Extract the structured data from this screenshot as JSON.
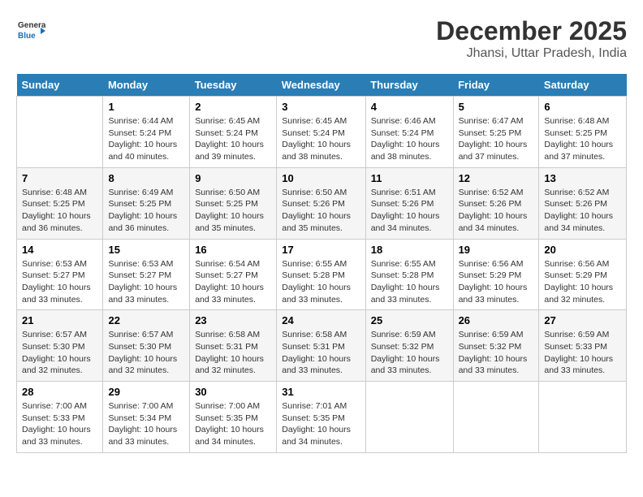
{
  "header": {
    "logo_line1": "General",
    "logo_line2": "Blue",
    "month_title": "December 2025",
    "subtitle": "Jhansi, Uttar Pradesh, India"
  },
  "days_of_week": [
    "Sunday",
    "Monday",
    "Tuesday",
    "Wednesday",
    "Thursday",
    "Friday",
    "Saturday"
  ],
  "weeks": [
    [
      {
        "day": "",
        "info": ""
      },
      {
        "day": "1",
        "info": "Sunrise: 6:44 AM\nSunset: 5:24 PM\nDaylight: 10 hours\nand 40 minutes."
      },
      {
        "day": "2",
        "info": "Sunrise: 6:45 AM\nSunset: 5:24 PM\nDaylight: 10 hours\nand 39 minutes."
      },
      {
        "day": "3",
        "info": "Sunrise: 6:45 AM\nSunset: 5:24 PM\nDaylight: 10 hours\nand 38 minutes."
      },
      {
        "day": "4",
        "info": "Sunrise: 6:46 AM\nSunset: 5:24 PM\nDaylight: 10 hours\nand 38 minutes."
      },
      {
        "day": "5",
        "info": "Sunrise: 6:47 AM\nSunset: 5:25 PM\nDaylight: 10 hours\nand 37 minutes."
      },
      {
        "day": "6",
        "info": "Sunrise: 6:48 AM\nSunset: 5:25 PM\nDaylight: 10 hours\nand 37 minutes."
      }
    ],
    [
      {
        "day": "7",
        "info": "Sunrise: 6:48 AM\nSunset: 5:25 PM\nDaylight: 10 hours\nand 36 minutes."
      },
      {
        "day": "8",
        "info": "Sunrise: 6:49 AM\nSunset: 5:25 PM\nDaylight: 10 hours\nand 36 minutes."
      },
      {
        "day": "9",
        "info": "Sunrise: 6:50 AM\nSunset: 5:25 PM\nDaylight: 10 hours\nand 35 minutes."
      },
      {
        "day": "10",
        "info": "Sunrise: 6:50 AM\nSunset: 5:26 PM\nDaylight: 10 hours\nand 35 minutes."
      },
      {
        "day": "11",
        "info": "Sunrise: 6:51 AM\nSunset: 5:26 PM\nDaylight: 10 hours\nand 34 minutes."
      },
      {
        "day": "12",
        "info": "Sunrise: 6:52 AM\nSunset: 5:26 PM\nDaylight: 10 hours\nand 34 minutes."
      },
      {
        "day": "13",
        "info": "Sunrise: 6:52 AM\nSunset: 5:26 PM\nDaylight: 10 hours\nand 34 minutes."
      }
    ],
    [
      {
        "day": "14",
        "info": "Sunrise: 6:53 AM\nSunset: 5:27 PM\nDaylight: 10 hours\nand 33 minutes."
      },
      {
        "day": "15",
        "info": "Sunrise: 6:53 AM\nSunset: 5:27 PM\nDaylight: 10 hours\nand 33 minutes."
      },
      {
        "day": "16",
        "info": "Sunrise: 6:54 AM\nSunset: 5:27 PM\nDaylight: 10 hours\nand 33 minutes."
      },
      {
        "day": "17",
        "info": "Sunrise: 6:55 AM\nSunset: 5:28 PM\nDaylight: 10 hours\nand 33 minutes."
      },
      {
        "day": "18",
        "info": "Sunrise: 6:55 AM\nSunset: 5:28 PM\nDaylight: 10 hours\nand 33 minutes."
      },
      {
        "day": "19",
        "info": "Sunrise: 6:56 AM\nSunset: 5:29 PM\nDaylight: 10 hours\nand 33 minutes."
      },
      {
        "day": "20",
        "info": "Sunrise: 6:56 AM\nSunset: 5:29 PM\nDaylight: 10 hours\nand 32 minutes."
      }
    ],
    [
      {
        "day": "21",
        "info": "Sunrise: 6:57 AM\nSunset: 5:30 PM\nDaylight: 10 hours\nand 32 minutes."
      },
      {
        "day": "22",
        "info": "Sunrise: 6:57 AM\nSunset: 5:30 PM\nDaylight: 10 hours\nand 32 minutes."
      },
      {
        "day": "23",
        "info": "Sunrise: 6:58 AM\nSunset: 5:31 PM\nDaylight: 10 hours\nand 32 minutes."
      },
      {
        "day": "24",
        "info": "Sunrise: 6:58 AM\nSunset: 5:31 PM\nDaylight: 10 hours\nand 33 minutes."
      },
      {
        "day": "25",
        "info": "Sunrise: 6:59 AM\nSunset: 5:32 PM\nDaylight: 10 hours\nand 33 minutes."
      },
      {
        "day": "26",
        "info": "Sunrise: 6:59 AM\nSunset: 5:32 PM\nDaylight: 10 hours\nand 33 minutes."
      },
      {
        "day": "27",
        "info": "Sunrise: 6:59 AM\nSunset: 5:33 PM\nDaylight: 10 hours\nand 33 minutes."
      }
    ],
    [
      {
        "day": "28",
        "info": "Sunrise: 7:00 AM\nSunset: 5:33 PM\nDaylight: 10 hours\nand 33 minutes."
      },
      {
        "day": "29",
        "info": "Sunrise: 7:00 AM\nSunset: 5:34 PM\nDaylight: 10 hours\nand 33 minutes."
      },
      {
        "day": "30",
        "info": "Sunrise: 7:00 AM\nSunset: 5:35 PM\nDaylight: 10 hours\nand 34 minutes."
      },
      {
        "day": "31",
        "info": "Sunrise: 7:01 AM\nSunset: 5:35 PM\nDaylight: 10 hours\nand 34 minutes."
      },
      {
        "day": "",
        "info": ""
      },
      {
        "day": "",
        "info": ""
      },
      {
        "day": "",
        "info": ""
      }
    ]
  ]
}
